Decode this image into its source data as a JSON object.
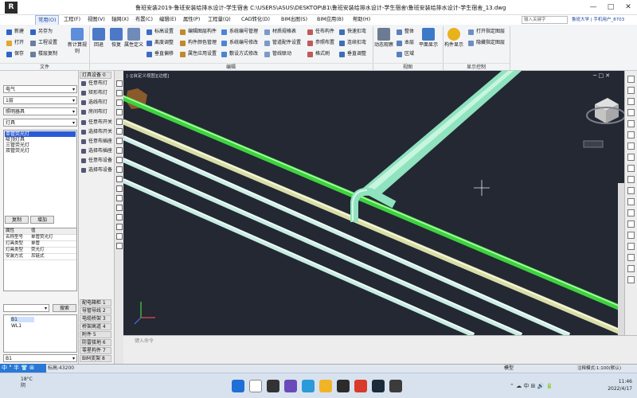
{
  "window": {
    "app_icon": "R",
    "title": "鲁班安装2019-鲁班安装给排水设计-学生宿舍    C:\\USERS\\ASUS\\DESKTOP\\B1\\鲁班安装给排水设计-学生宿舍\\鲁班安装给排水设计-学生宿舍_13.dwg",
    "minimize": "—",
    "maximize": "□",
    "close": "✕"
  },
  "tabs": [
    "常用(O)",
    "工程(F)",
    "视图(V)",
    "轴网(X)",
    "布置(C)",
    "编辑(E)",
    "属性(P)",
    "工程量(Q)",
    "CAD转化(D)",
    "BIM出图(S)",
    "BIM应用(B)",
    "帮助(H)"
  ],
  "search_placeholder": "输入关键字",
  "login": "鲁班大学 | 手机用户_8703",
  "ribbon": {
    "file": [
      "新建",
      "打开",
      "保存",
      "另存为",
      "工程设置",
      "楼层复制"
    ],
    "file_big": "新计算规则",
    "undo": "回退",
    "redo": "恢复",
    "attr_def": "属性定义",
    "edit1": [
      "标高设置",
      "离度调整",
      "垂直偏移"
    ],
    "edit2": [
      "编辑图层构件",
      "构件颜色管理",
      "属性应用设置"
    ],
    "edit3": [
      "系统编号管理",
      "系统编号修改",
      "敷设方式修改"
    ],
    "edit4": [
      "材质规格表",
      "管道配件设置",
      "管线联动"
    ],
    "edit5": [
      "任布构件",
      "参照布置",
      "格式刷"
    ],
    "edit6": [
      "快速扣弯",
      "连续扣弯",
      "垂直调整"
    ],
    "view_big": [
      "动态观察"
    ],
    "view_small": [
      "整体",
      "本层",
      "区域"
    ],
    "view_big2": "平面显示",
    "disp_big": "构件显示",
    "disp": [
      "打开指定图层",
      "隐藏指定图层"
    ],
    "groups": [
      "文件",
      "编辑",
      "视图",
      "显示控制"
    ]
  },
  "left": {
    "combos": [
      "电气",
      "1层",
      "照明器具",
      "灯具",
      "任意布灯"
    ],
    "items": [
      "单管荧光灯",
      "吸顶灯具",
      "三管荧光灯",
      "双管荧光灯"
    ],
    "copy": "复制",
    "add": "增加",
    "props_header": [
      "属性",
      "值"
    ],
    "props": [
      [
        "名称型号",
        "单管荧光灯"
      ],
      [
        "灯具类型",
        "单管"
      ],
      [
        "灯具类型",
        "荧光灯"
      ],
      [
        "安装方式",
        "吊链式"
      ]
    ],
    "search_btn": "搜索",
    "tree": [
      "B1",
      "WL1"
    ],
    "bottom": "B1"
  },
  "commands": {
    "header": "灯具设备 0",
    "items": [
      "任意布灯",
      "矩形布灯",
      "选线布灯",
      "房间布灯",
      "任意布开关",
      "选择布开关",
      "任意布插座",
      "选择布插座",
      "任意布设备",
      "选择布设备"
    ],
    "sections": [
      "配电箱柜 1",
      "导管导线 2",
      "电缆桥架 3",
      "桥架高道 4",
      "附件 5",
      "防雷接地 6",
      "零星构件 7",
      "BIM支架 8"
    ]
  },
  "viewport": {
    "label": "[-][自定义视图][边框]",
    "nav": "─ □ ✕"
  },
  "cmdline": {
    "prompt": "键入命令"
  },
  "status": {
    "ime": "中 ° 半 👕 ⊞",
    "coords": "标高:43200",
    "model": "模型",
    "annotation": "注释模式:1:100(默认)"
  },
  "taskbar": {
    "temp": "18°C",
    "weather": "阴",
    "time": "11:46",
    "date": "2022/4/17"
  },
  "colors": {
    "accent": "#1a46a0",
    "select": "#2a5bd7",
    "bg": "#232833",
    "pipe_green": "#3fd23f",
    "pipe_light": "#dfe7c4",
    "pipe_mint": "#8fe3be"
  }
}
